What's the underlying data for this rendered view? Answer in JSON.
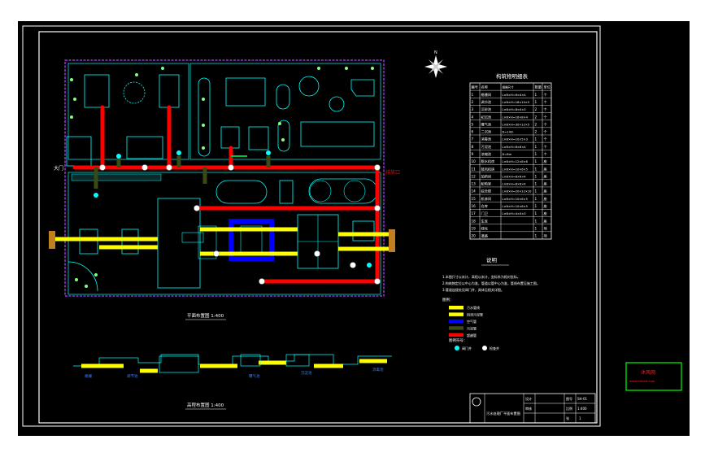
{
  "compass": {
    "label": "N"
  },
  "site_plan": {
    "gate_label": "大门",
    "outlet_label": "排放口",
    "plan_scale_label": "平面布置图 1:400",
    "profile_scale_label": "高程布置图 1:400",
    "profile_stations": [
      "格栅",
      "调节池",
      "曝气池",
      "沉淀池",
      "消毒池"
    ]
  },
  "structure_table": {
    "title": "构筑物明细表",
    "headers": [
      "编号",
      "名称",
      "规格尺寸",
      "数量",
      "单位"
    ],
    "rows": [
      [
        "1",
        "格栅间",
        "L×B×H=6×4×4",
        "1",
        "个"
      ],
      [
        "2",
        "调节池",
        "L×B×H=18×10×5",
        "1",
        "个"
      ],
      [
        "3",
        "沉砂池",
        "L×B×H=8×4×3",
        "2",
        "个"
      ],
      [
        "4",
        "初沉池",
        "L×B×H=16×8×4",
        "2",
        "个"
      ],
      [
        "5",
        "曝气池",
        "L×B×H=30×12×5",
        "2",
        "个"
      ],
      [
        "6",
        "二沉池",
        "D=14m",
        "2",
        "个"
      ],
      [
        "7",
        "消毒池",
        "L×B×H=10×5×3",
        "1",
        "个"
      ],
      [
        "8",
        "污泥池",
        "L×B×H=8×8×4",
        "1",
        "个"
      ],
      [
        "9",
        "浓缩池",
        "D=8m",
        "1",
        "个"
      ],
      [
        "10",
        "脱水机房",
        "L×B×H=12×8×6",
        "1",
        "座"
      ],
      [
        "11",
        "鼓风机房",
        "L×B×H=10×6×5",
        "1",
        "座"
      ],
      [
        "12",
        "加药间",
        "L×B×H=8×6×4",
        "1",
        "座"
      ],
      [
        "13",
        "配电室",
        "L×B×H=8×6×4",
        "1",
        "座"
      ],
      [
        "14",
        "综合楼",
        "L×B×H=20×12×10",
        "1",
        "座"
      ],
      [
        "15",
        "机修间",
        "L×B×H=10×6×5",
        "1",
        "座"
      ],
      [
        "16",
        "仓库",
        "L×B×H=10×6×5",
        "1",
        "座"
      ],
      [
        "17",
        "门卫",
        "L×B×H=4×4×3",
        "1",
        "座"
      ],
      [
        "18",
        "车库",
        "",
        "1",
        "座"
      ],
      [
        "19",
        "绿化",
        "",
        "1",
        "项"
      ],
      [
        "20",
        "道路",
        "",
        "1",
        "项"
      ]
    ]
  },
  "notes": {
    "title": "说明",
    "lines": [
      "1.本图尺寸以米计，高程以米计，坐标系为相对坐标。",
      "2.构筑物定位以中心为准，管道以管中心为准，管线布置见施工图。",
      "3.管道连接处设阀门井，具体见相关详图。"
    ],
    "legend_title": "图例：",
    "legend": [
      {
        "label": "污水管线",
        "color": "#ffff00"
      },
      {
        "label": "回流污泥管",
        "color": "#ffff00"
      },
      {
        "label": "空气管",
        "color": "#0000ff"
      },
      {
        "label": "污泥管",
        "color": "#3a4a14"
      },
      {
        "label": "超越管",
        "color": "#ff0000"
      }
    ],
    "symbols_title": "图例符号：",
    "symbols": [
      {
        "label": "阀门井",
        "color": "#00ffff"
      },
      {
        "label": "检查井",
        "color": "#ffffff"
      }
    ]
  },
  "title_block": {
    "drawing_title": "污水处理厂平面布置图",
    "designer_label": "设计",
    "checker_label": "审核",
    "number_label": "图号",
    "number_value": "SH-01",
    "scale_label": "比例",
    "scale_value": "1:400",
    "sheet_label": "张",
    "sheet_value": "1"
  },
  "watermark": {
    "title": "沐风网",
    "subtitle": "www.mfcad.com"
  }
}
